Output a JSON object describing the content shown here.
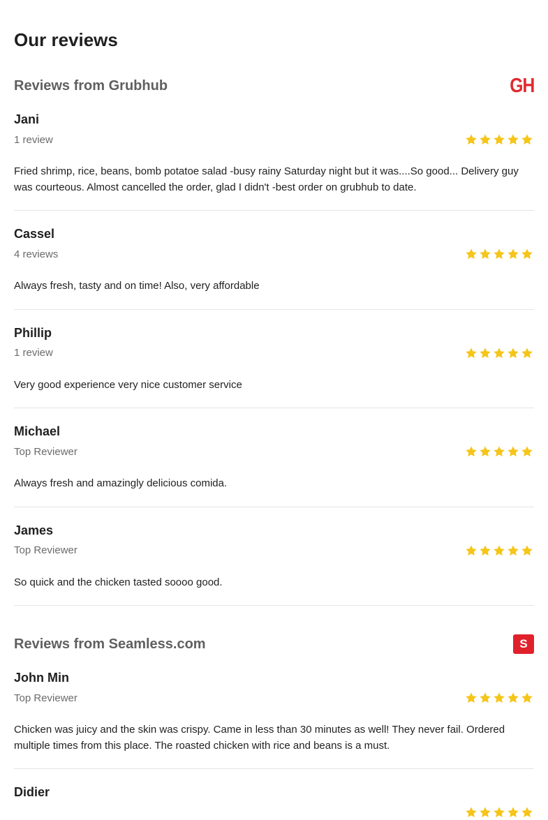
{
  "page": {
    "title": "Our reviews"
  },
  "colors": {
    "star": "#f5c518",
    "grubhub_red": "#e0292f",
    "seamless_red": "#e0212c"
  },
  "sources": [
    {
      "title": "Reviews from Grubhub",
      "logo": {
        "icon": "grubhub-logo-icon",
        "text": "GH"
      },
      "reviews": [
        {
          "name": "Jani",
          "meta": "1 review",
          "rating": 5,
          "text": "Fried shrimp, rice, beans, bomb potatoe salad -busy rainy Saturday night but it was....So good... Delivery guy was courteous. Almost cancelled the order, glad I didn't -best order on grubhub to date."
        },
        {
          "name": "Cassel",
          "meta": "4 reviews",
          "rating": 5,
          "text": "Always fresh, tasty and on time! Also, very affordable"
        },
        {
          "name": "Phillip",
          "meta": "1 review",
          "rating": 5,
          "text": "Very good experience very nice customer service"
        },
        {
          "name": "Michael",
          "meta": "Top Reviewer",
          "rating": 5,
          "text": "Always fresh and amazingly delicious comida."
        },
        {
          "name": "James",
          "meta": "Top Reviewer",
          "rating": 5,
          "text": "So quick and the chicken tasted soooo good."
        }
      ]
    },
    {
      "title": "Reviews from Seamless.com",
      "logo": {
        "icon": "seamless-logo-icon",
        "text": "S"
      },
      "reviews": [
        {
          "name": "John Min",
          "meta": "Top Reviewer",
          "rating": 5,
          "text": "Chicken was juicy and the skin was crispy. Came in less than 30 minutes as well! They never fail. Ordered multiple times from this place. The roasted chicken with rice and beans is a must."
        },
        {
          "name": "Didier",
          "meta": "",
          "rating": 5,
          "text": ""
        }
      ]
    }
  ]
}
